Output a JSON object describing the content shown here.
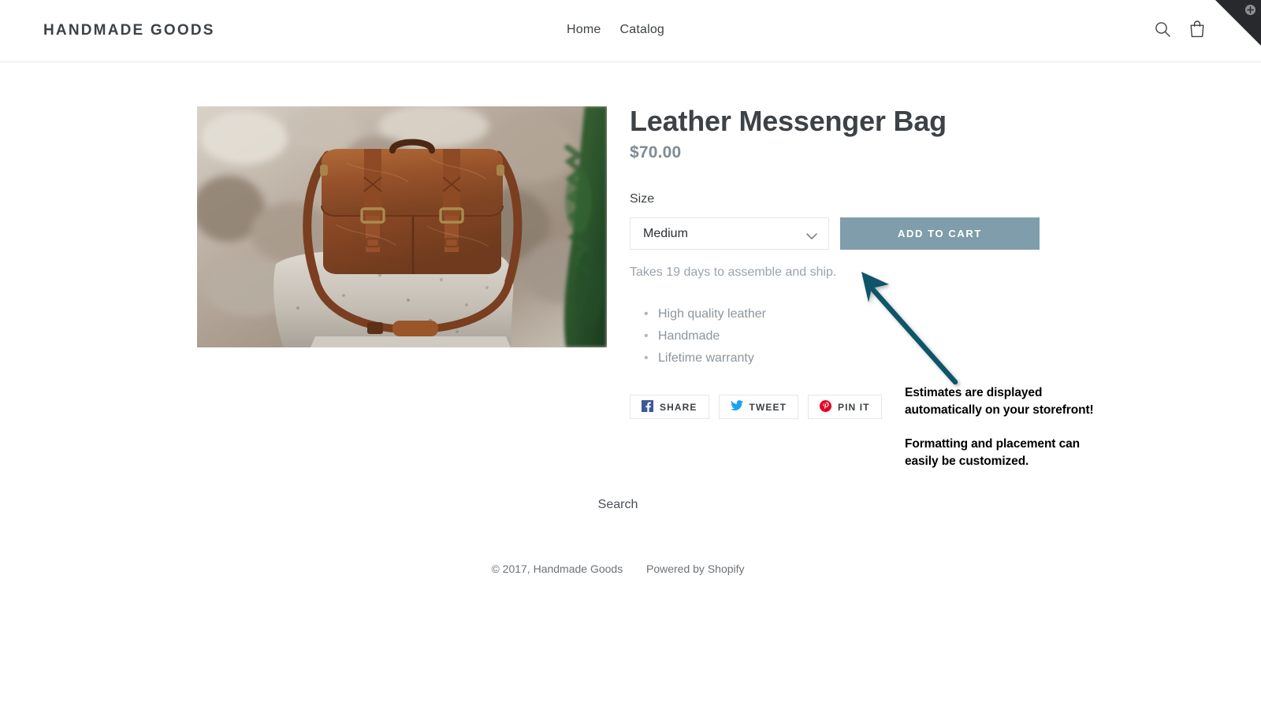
{
  "header": {
    "brand": "HANDMADE GOODS",
    "nav": [
      {
        "label": "Home"
      },
      {
        "label": "Catalog"
      }
    ],
    "icons": [
      {
        "name": "search-icon",
        "label": "Search"
      },
      {
        "name": "cart-icon",
        "label": "Cart"
      }
    ],
    "corner_badge": {
      "icon": "plus-circle-icon",
      "color": "#27292c"
    }
  },
  "product": {
    "title": "Leather Messenger Bag",
    "price": "$70.00",
    "image_alt": "Brown leather messenger bag resting on a granite stone in front of a stone wall",
    "option_label": "Size",
    "selected_variant": "Medium",
    "variant_options": [
      "Medium"
    ],
    "add_to_cart_label": "ADD TO CART",
    "delivery_estimate": "Takes 19 days to assemble and ship.",
    "features": [
      "High quality leather",
      "Handmade",
      "Lifetime warranty"
    ],
    "share_buttons": [
      {
        "icon": "facebook-icon",
        "label": "SHARE"
      },
      {
        "icon": "twitter-icon",
        "label": "TWEET"
      },
      {
        "icon": "pinterest-icon",
        "label": "PIN IT"
      }
    ]
  },
  "footer": {
    "links": [
      {
        "label": "Search"
      }
    ],
    "copyright": "© 2017, Handmade Goods",
    "powered_by": "Powered by Shopify"
  },
  "annotations": {
    "arrow_color": "#0d5569",
    "note_1": "Estimates are displayed automatically on your storefront!",
    "note_2": "Formatting and placement can easily be customized."
  },
  "colors": {
    "accent_button": "#7f9daa",
    "title_text": "#3d4246",
    "muted_text": "#9aa3ac",
    "facebook": "#3b5998",
    "twitter": "#1da1f2",
    "pinterest": "#e60023"
  }
}
